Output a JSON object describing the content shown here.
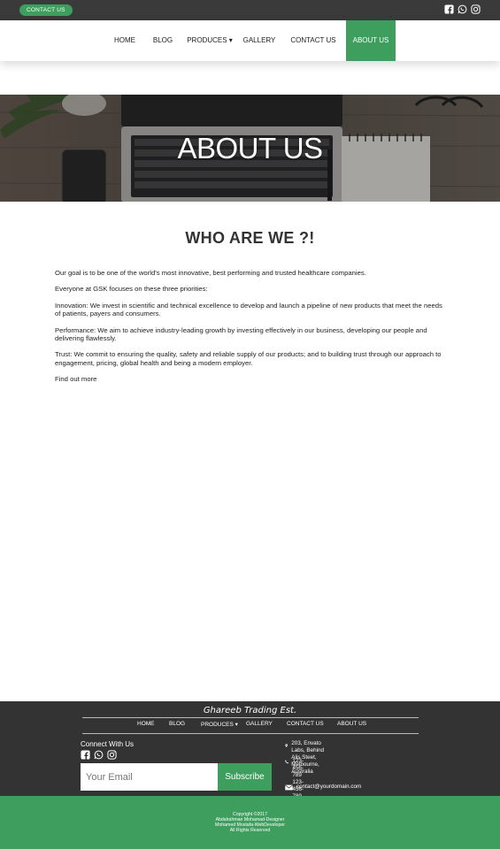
{
  "topbar": {
    "contact_label": "CONTACT US",
    "social_icons": [
      "facebook-icon",
      "whatsapp-icon",
      "instagram-icon"
    ]
  },
  "nav": {
    "items": [
      {
        "label": "HOME"
      },
      {
        "label": "BLOG"
      },
      {
        "label": "PRODUCES ▾"
      },
      {
        "label": "GALLERY"
      },
      {
        "label": "CONTACT US"
      },
      {
        "label": "ABOUT US"
      }
    ],
    "active": "ABOUT US"
  },
  "hero": {
    "title": "ABOUT US"
  },
  "main": {
    "heading": "WHO ARE WE ?!",
    "paragraphs": [
      "Our goal is to be one of the world's most innovative, best performing and trusted healthcare companies.",
      "Everyone at GSK focuses on these three priorities:",
      "Innovation: We invest in scientific and technical excellence to develop and launch a pipeline of new products that meet the needs of patients, payers and consumers.",
      "Performance: We aim to achieve industry-leading growth by investing effectively in our business, developing our people and delivering flawlessly.",
      "Trust: We commit to ensuring the quality, safety and reliable supply of our products; and to building trust through our approach to engagement, pricing, global health and being a modern employer."
    ],
    "link": "Find out more"
  },
  "footer": {
    "brand": "Ghareeb Trading Est.",
    "nav": [
      "HOME",
      "BLOG",
      "PRODUCES ▾",
      "GALLERY",
      "CONTACT US",
      "ABOUT US"
    ],
    "connect_label": "Connect With Us",
    "email_placeholder": "Your Email",
    "subscribe_label": "Subscribe",
    "address_line1": "203, Envato Labs, Behind Alis Steet,",
    "address_line2": "Melbourne, Australia",
    "phones": [
      "123-456-789",
      "123-456-789",
      "123-456-789"
    ],
    "email": "contact@yourdomain.com"
  },
  "copyright": {
    "lines": [
      "Copyright ©2017",
      "Abdalrahman Mohamad-Designer",
      "Mohamed Mostafa-WebDeveloper",
      "All Rights Reserved"
    ]
  },
  "colors": {
    "accent": "#3d9e5d",
    "dark": "#333333",
    "topbar": "#3a3a3a"
  }
}
